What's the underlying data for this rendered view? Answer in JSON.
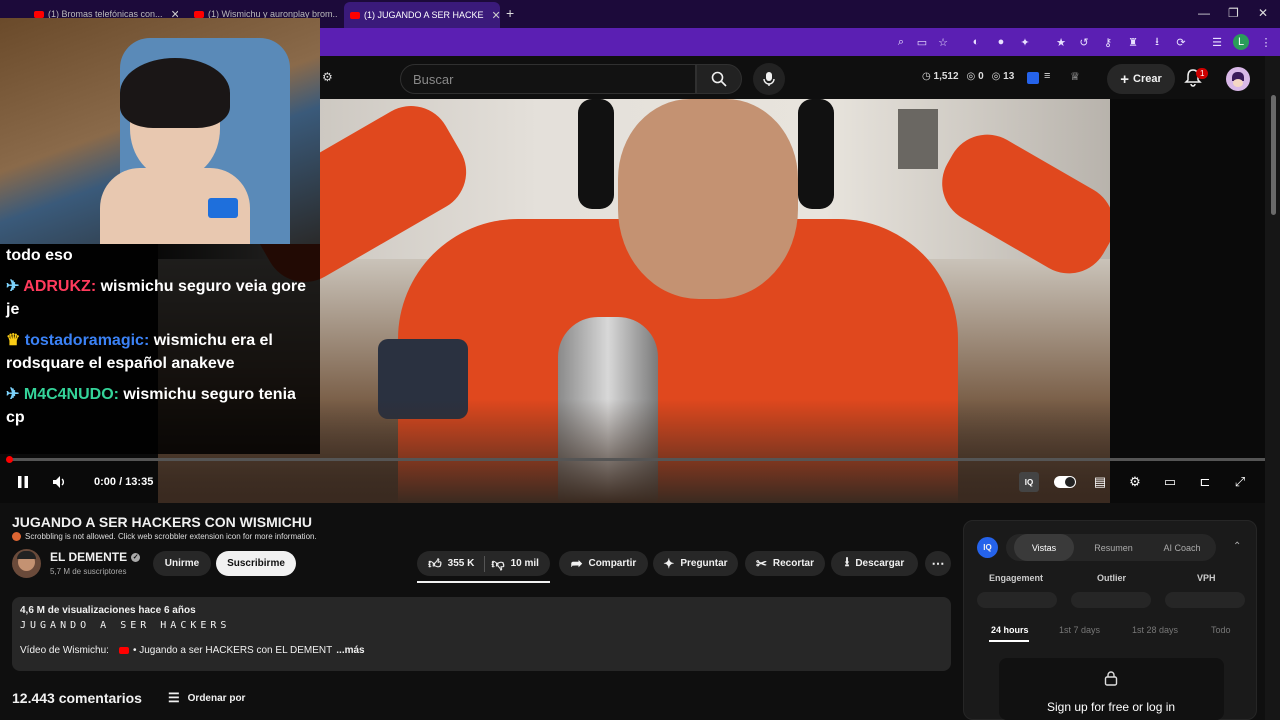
{
  "browser": {
    "tabs": [
      {
        "label": "(1) Bromas telefónicas con..."
      },
      {
        "label": "(1) Wismichu y auronplay brom..."
      },
      {
        "label": "(1) JUGANDO A SER HACKE"
      }
    ],
    "new_tab": "+"
  },
  "youtube_header": {
    "search_placeholder": "Buscar",
    "stats": {
      "views": "1,512",
      "watching": "0",
      "other": "13"
    },
    "create_label": "Crear",
    "notifications": "1"
  },
  "chat": {
    "lines": [
      {
        "user": "",
        "message": "todo eso"
      },
      {
        "user": "ADRUKZ:",
        "message": " wismichu seguro veia gore je",
        "color": "#ff3b5c"
      },
      {
        "user": "tostadoramagic:",
        "message": " wismichu era el rodsquare el español anakeve",
        "color": "#3b82f6"
      },
      {
        "user": "M4C4NUDO:",
        "message": " wismichu seguro tenia cp",
        "color": "#34d399"
      }
    ]
  },
  "player": {
    "time": "0:00 / 13:35",
    "progress": 0.0
  },
  "video": {
    "title": "JUGANDO A SER HACKERS CON WISMICHU",
    "scrobble_notice": "Scrobbling is not allowed. Click web scrobbler extension icon for more information.",
    "channel": {
      "name": "EL DEMENTE",
      "subs": "5,7 M de suscriptores"
    },
    "join_label": "Unirme",
    "subscribe_label": "Suscribirme",
    "likes": "355 K",
    "dislikes": "10 mil",
    "share_label": "Compartir",
    "ask_label": "Preguntar",
    "clip_label": "Recortar",
    "download_label": "Descargar",
    "description": {
      "meta": "4,6 M de visualizaciones  hace 6 años",
      "title_line": "JUGANDO A SER HACKERS",
      "source_label": "Vídeo de Wismichu:",
      "source_link": "• Jugando a ser HACKERS con EL DEMENT",
      "more": "...más"
    },
    "comments_count": "12.443 comentarios",
    "sort_label": "Ordenar por"
  },
  "iq_panel": {
    "logo": "IQ",
    "tabs": [
      "Vistas",
      "Resumen",
      "AI Coach"
    ],
    "metrics": [
      "Engagement",
      "Outlier",
      "VPH"
    ],
    "ranges": [
      "24 hours",
      "1st 7 days",
      "1st 28 days",
      "Todo"
    ],
    "signup": "Sign up for free or log in"
  }
}
